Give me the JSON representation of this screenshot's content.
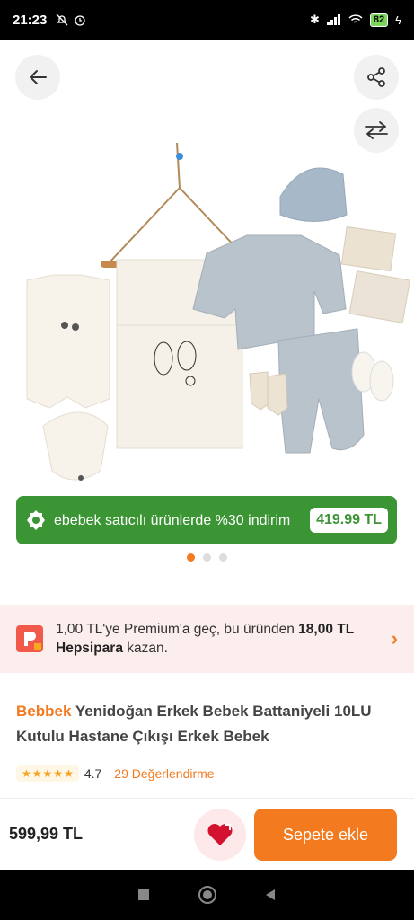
{
  "status_bar": {
    "time": "21:23",
    "battery": "82"
  },
  "hero": {
    "product_image_icon": "baby-clothing-set-image",
    "promo": {
      "text": "ebebek satıcılı ürünlerde %30 indirim",
      "price": "419.99 TL"
    },
    "image_count": 3,
    "active_image_index": 0
  },
  "premium": {
    "text_part1": "1,00 TL'ye Premium'a geç, bu üründen ",
    "text_bold1": "18,00 TL Hepsipara",
    "text_part2": " kazan."
  },
  "product": {
    "brand": "Bebbek",
    "name": " Yenidoğan Erkek Bebek Battaniyeli 10LU Kutulu Hastane Çıkışı Erkek Bebek",
    "rating": "4.7",
    "reviews": "29 Değerlendirme"
  },
  "bottom": {
    "price": "599,99 TL",
    "cart_label": "Sepete ekle"
  },
  "colors": {
    "accent": "#f37a1f",
    "promo_green": "#3b9534"
  }
}
